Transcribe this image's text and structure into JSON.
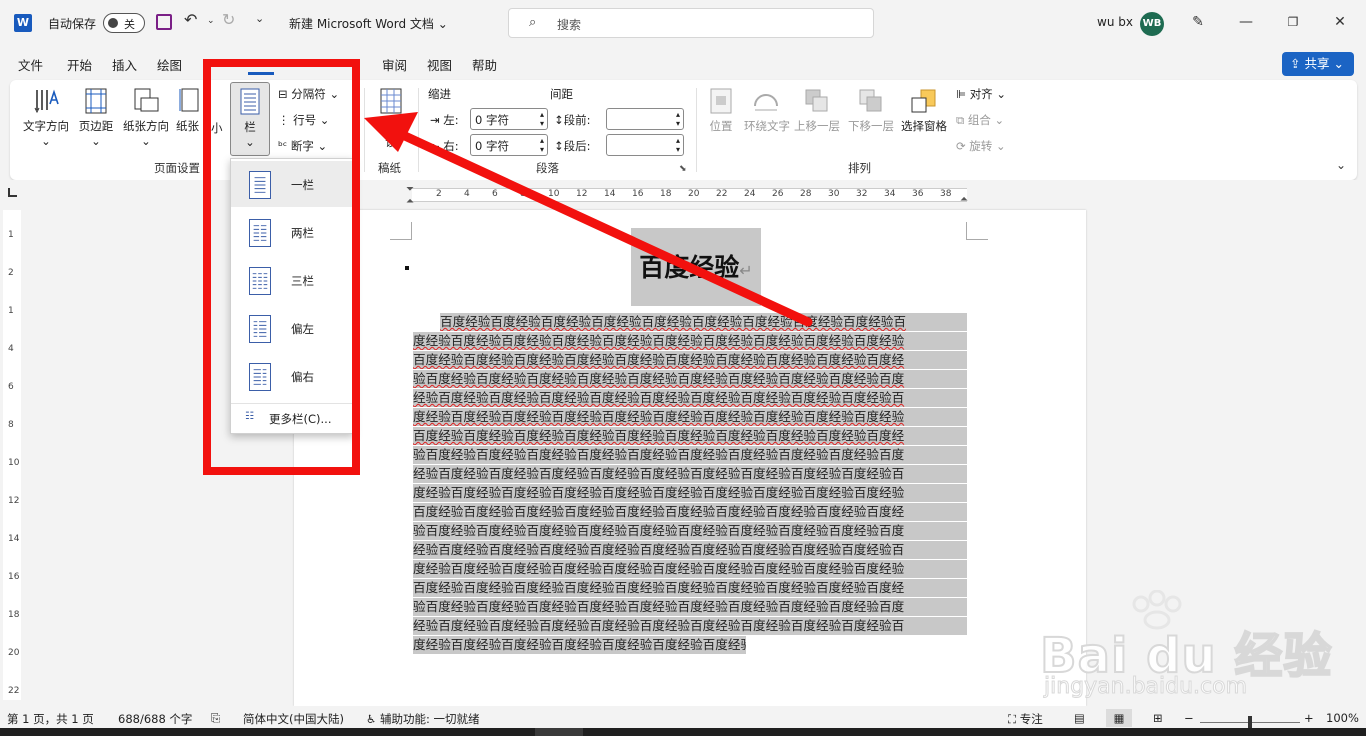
{
  "titlebar": {
    "autosave_label": "自动保存",
    "autosave_state": "关",
    "doc_title": "新建 Microsoft Word 文档",
    "search_placeholder": "搜索",
    "user_name": "wu bx",
    "user_initials": "WB"
  },
  "tabs": [
    "文件",
    "开始",
    "插入",
    "绘图",
    "审阅",
    "视图",
    "帮助"
  ],
  "share_label": "共享",
  "ribbon": {
    "page_setup": {
      "text_direction": "文字方向",
      "margins": "页边距",
      "orientation": "纸张方向",
      "size_partial": "纸张",
      "size_suffix": "小",
      "columns": "栏",
      "breaks": "分隔符",
      "line_numbers": "行号",
      "hyphenation": "断字",
      "group_label": "页面设置"
    },
    "manuscript": {
      "button": "稿纸",
      "button_sub": "设",
      "group_label": "稿纸"
    },
    "paragraph": {
      "indent_label": "缩进",
      "spacing_label": "间距",
      "left_label": "左:",
      "right_label": "右:",
      "left_value": "0 字符",
      "right_value": "0 字符",
      "before_label": "段前:",
      "after_label": "段后:",
      "group_label": "段落"
    },
    "arrange": {
      "position": "位置",
      "wrap_text": "环绕文字",
      "bring_forward": "上移一层",
      "send_backward": "下移一层",
      "selection_pane": "选择窗格",
      "align": "对齐",
      "group": "组合",
      "rotate": "旋转",
      "group_label": "排列"
    }
  },
  "ruler_numbers": [
    "2",
    "4",
    "6",
    "8",
    "10",
    "12",
    "14",
    "16",
    "18",
    "20",
    "22",
    "24",
    "26",
    "28",
    "30",
    "32",
    "34",
    "36",
    "38"
  ],
  "vruler_numbers": [
    "1",
    "2",
    "1",
    "4",
    "6",
    "8",
    "10",
    "12",
    "14",
    "16",
    "18",
    "20",
    "22"
  ],
  "columns_menu": {
    "items": [
      "一栏",
      "两栏",
      "三栏",
      "偏左",
      "偏右"
    ],
    "more": "更多栏(C)..."
  },
  "document": {
    "title": "百度经验",
    "lines": [
      "百度经验百度经验百度经验百度经验百度经验百度经验百度经验百度经验百度经验百",
      "度经验百度经验百度经验百度经验百度经验百度经验百度经验百度经验百度经验百度经验",
      "百度经验百度经验百度经验百度经验百度经验百度经验百度经验百度经验百度经验百度经",
      "验百度经验百度经验百度经验百度经验百度经验百度经验百度经验百度经验百度经验百度",
      "经验百度经验百度经验百度经验百度经验百度经验百度经验百度经验百度经验百度经验百",
      "度经验百度经验百度经验百度经验百度经验百度经验百度经验百度经验百度经验百度经验",
      "百度经验百度经验百度经验百度经验百度经验百度经验百度经验百度经验百度经验百度经",
      "验百度经验百度经验百度经验百度经验百度经验百度经验百度经验百度经验百度经验百度",
      "经验百度经验百度经验百度经验百度经验百度经验百度经验百度经验百度经验百度经验百",
      "度经验百度经验百度经验百度经验百度经验百度经验百度经验百度经验百度经验百度经验",
      "百度经验百度经验百度经验百度经验百度经验百度经验百度经验百度经验百度经验百度经",
      "验百度经验百度经验百度经验百度经验百度经验百度经验百度经验百度经验百度经验百度",
      "经验百度经验百度经验百度经验百度经验百度经验百度经验百度经验百度经验百度经验百",
      "度经验百度经验百度经验百度经验百度经验百度经验百度经验百度经验百度经验百度经验",
      "百度经验百度经验百度经验百度经验百度经验百度经验百度经验百度经验百度经验百度经",
      "验百度经验百度经验百度经验百度经验百度经验百度经验百度经验百度经验百度经验百度",
      "经验百度经验百度经验百度经验百度经验百度经验百度经验百度经验百度经验百度经验百",
      "度经验百度经验百度经验百度经验百度经验百度经验百度经验"
    ]
  },
  "statusbar": {
    "page": "第 1 页，共 1 页",
    "words": "688/688 个字",
    "language": "简体中文(中国大陆)",
    "accessibility": "辅助功能: 一切就绪",
    "focus": "专注",
    "zoom": "100%"
  },
  "watermark": {
    "brand": "Bai du 经验",
    "url": "jingyan.baidu.com"
  },
  "colors": {
    "word_blue": "#185abd",
    "share_blue": "#1b64c4",
    "annotation_red": "#f2110e",
    "selection_gray": "#c8c8c8"
  }
}
